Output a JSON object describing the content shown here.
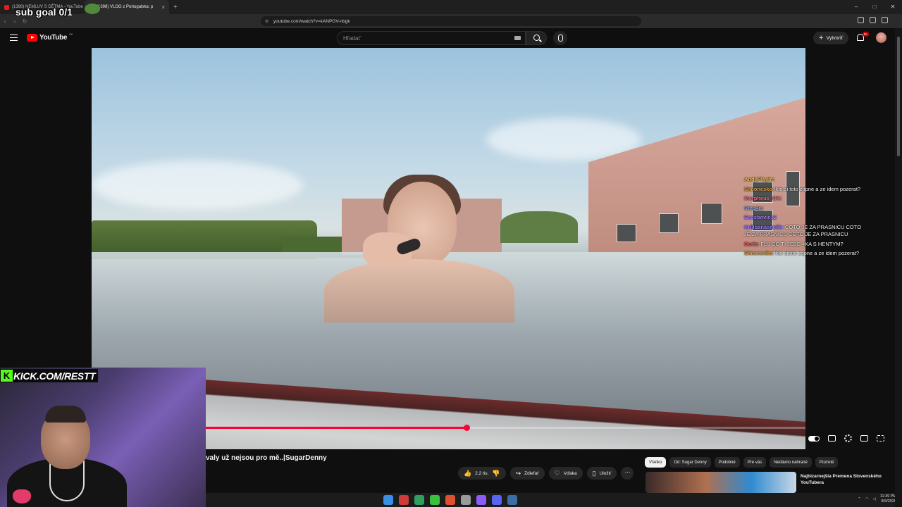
{
  "browser": {
    "tabs": [
      {
        "label": "(1398) NEMLUV S DĚTMA - YouTube",
        "active": false
      },
      {
        "label": "(1398) VLOG z Portugalska: p",
        "active": true
      }
    ],
    "url": "youtube.com/watch?v=kANPGV-nbgk",
    "new_tab": "+",
    "window_controls": [
      "–",
      "□",
      "✕"
    ]
  },
  "youtube": {
    "logo_text": "YouTube",
    "logo_region": "SK",
    "search_placeholder": "Hľadať",
    "create_label": "Vytvoriť",
    "notification_badge": "9+"
  },
  "overlay": {
    "sub_goal": "sub goal 0/1",
    "kick_label": "KICK.COM/RESTT"
  },
  "chat": [
    {
      "user": "AndyPlayin:",
      "msg": "",
      "color": "#f0c35a"
    },
    {
      "user": "Simonesko:",
      "msg": "kto si toto zapne a ze idem pozerat?",
      "color": "#e0a050"
    },
    {
      "user": "Morpheus_OK:",
      "msg": "",
      "color": "#ff6b8a"
    },
    {
      "user": "Step4n:",
      "msg": "",
      "color": "#8fa8ff"
    },
    {
      "user": "Bassbovic12",
      "msg": "",
      "color": "#b080ff"
    },
    {
      "user": "Krillbanaseniik:",
      "msg": "COTO JE ZA PRASNICU COTO JE ZA PRASNICU COTO JE ZA PRASNICU",
      "color": "#9a80ff"
    },
    {
      "user": "Buriz:",
      "msg": "FUJ CO TI JEBE 4KA S HENTYM?",
      "color": "#ff5a5a"
    },
    {
      "user": "Simonesko:",
      "msg": "kto sitoto zapne a ze idem pozerat?",
      "color": "#e0a050"
    }
  ],
  "player": {
    "progress": 0.435,
    "title": "valy už nejsou pro mě..|SugarDenny"
  },
  "actions": {
    "like_count": "2,2 tis.",
    "share": "Zdieľať",
    "thanks": "Vďaka",
    "save": "Uložiť",
    "more": "⋯"
  },
  "chips": [
    "Všetko",
    "Od: Sugar Denny",
    "Podobné",
    "Pre vás",
    "Nedávno nahrané",
    "Pozreté"
  ],
  "recommendation": {
    "title": "Najbizarnejšia Premena Slovenského YouTubera"
  },
  "taskbar": {
    "time": "11:39 PM",
    "date": "8/9/2026",
    "apps": [
      "#3a8ee6",
      "#d03a3a",
      "#2f9e5e",
      "#3cbf3c",
      "#e05030",
      "#9a9a9a",
      "#8b5cf6",
      "#5865f2",
      "#3a6ea5"
    ]
  }
}
